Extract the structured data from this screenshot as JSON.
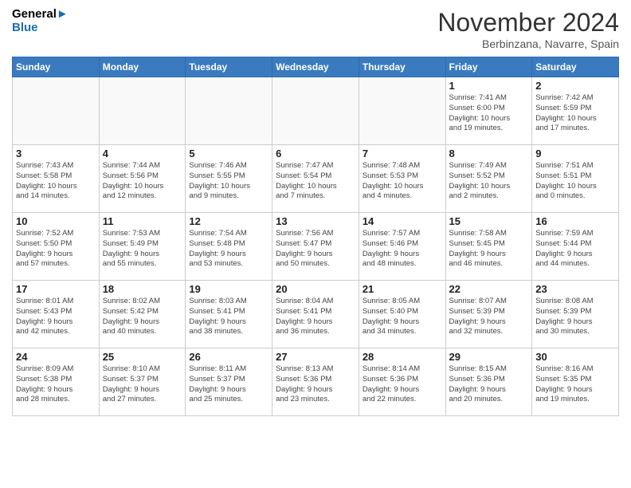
{
  "header": {
    "logo_line1": "General",
    "logo_line2": "Blue",
    "month": "November 2024",
    "location": "Berbinzana, Navarre, Spain"
  },
  "weekdays": [
    "Sunday",
    "Monday",
    "Tuesday",
    "Wednesday",
    "Thursday",
    "Friday",
    "Saturday"
  ],
  "weeks": [
    [
      {
        "day": "",
        "info": ""
      },
      {
        "day": "",
        "info": ""
      },
      {
        "day": "",
        "info": ""
      },
      {
        "day": "",
        "info": ""
      },
      {
        "day": "",
        "info": ""
      },
      {
        "day": "1",
        "info": "Sunrise: 7:41 AM\nSunset: 6:00 PM\nDaylight: 10 hours\nand 19 minutes."
      },
      {
        "day": "2",
        "info": "Sunrise: 7:42 AM\nSunset: 5:59 PM\nDaylight: 10 hours\nand 17 minutes."
      }
    ],
    [
      {
        "day": "3",
        "info": "Sunrise: 7:43 AM\nSunset: 5:58 PM\nDaylight: 10 hours\nand 14 minutes."
      },
      {
        "day": "4",
        "info": "Sunrise: 7:44 AM\nSunset: 5:56 PM\nDaylight: 10 hours\nand 12 minutes."
      },
      {
        "day": "5",
        "info": "Sunrise: 7:46 AM\nSunset: 5:55 PM\nDaylight: 10 hours\nand 9 minutes."
      },
      {
        "day": "6",
        "info": "Sunrise: 7:47 AM\nSunset: 5:54 PM\nDaylight: 10 hours\nand 7 minutes."
      },
      {
        "day": "7",
        "info": "Sunrise: 7:48 AM\nSunset: 5:53 PM\nDaylight: 10 hours\nand 4 minutes."
      },
      {
        "day": "8",
        "info": "Sunrise: 7:49 AM\nSunset: 5:52 PM\nDaylight: 10 hours\nand 2 minutes."
      },
      {
        "day": "9",
        "info": "Sunrise: 7:51 AM\nSunset: 5:51 PM\nDaylight: 10 hours\nand 0 minutes."
      }
    ],
    [
      {
        "day": "10",
        "info": "Sunrise: 7:52 AM\nSunset: 5:50 PM\nDaylight: 9 hours\nand 57 minutes."
      },
      {
        "day": "11",
        "info": "Sunrise: 7:53 AM\nSunset: 5:49 PM\nDaylight: 9 hours\nand 55 minutes."
      },
      {
        "day": "12",
        "info": "Sunrise: 7:54 AM\nSunset: 5:48 PM\nDaylight: 9 hours\nand 53 minutes."
      },
      {
        "day": "13",
        "info": "Sunrise: 7:56 AM\nSunset: 5:47 PM\nDaylight: 9 hours\nand 50 minutes."
      },
      {
        "day": "14",
        "info": "Sunrise: 7:57 AM\nSunset: 5:46 PM\nDaylight: 9 hours\nand 48 minutes."
      },
      {
        "day": "15",
        "info": "Sunrise: 7:58 AM\nSunset: 5:45 PM\nDaylight: 9 hours\nand 46 minutes."
      },
      {
        "day": "16",
        "info": "Sunrise: 7:59 AM\nSunset: 5:44 PM\nDaylight: 9 hours\nand 44 minutes."
      }
    ],
    [
      {
        "day": "17",
        "info": "Sunrise: 8:01 AM\nSunset: 5:43 PM\nDaylight: 9 hours\nand 42 minutes."
      },
      {
        "day": "18",
        "info": "Sunrise: 8:02 AM\nSunset: 5:42 PM\nDaylight: 9 hours\nand 40 minutes."
      },
      {
        "day": "19",
        "info": "Sunrise: 8:03 AM\nSunset: 5:41 PM\nDaylight: 9 hours\nand 38 minutes."
      },
      {
        "day": "20",
        "info": "Sunrise: 8:04 AM\nSunset: 5:41 PM\nDaylight: 9 hours\nand 36 minutes."
      },
      {
        "day": "21",
        "info": "Sunrise: 8:05 AM\nSunset: 5:40 PM\nDaylight: 9 hours\nand 34 minutes."
      },
      {
        "day": "22",
        "info": "Sunrise: 8:07 AM\nSunset: 5:39 PM\nDaylight: 9 hours\nand 32 minutes."
      },
      {
        "day": "23",
        "info": "Sunrise: 8:08 AM\nSunset: 5:39 PM\nDaylight: 9 hours\nand 30 minutes."
      }
    ],
    [
      {
        "day": "24",
        "info": "Sunrise: 8:09 AM\nSunset: 5:38 PM\nDaylight: 9 hours\nand 28 minutes."
      },
      {
        "day": "25",
        "info": "Sunrise: 8:10 AM\nSunset: 5:37 PM\nDaylight: 9 hours\nand 27 minutes."
      },
      {
        "day": "26",
        "info": "Sunrise: 8:11 AM\nSunset: 5:37 PM\nDaylight: 9 hours\nand 25 minutes."
      },
      {
        "day": "27",
        "info": "Sunrise: 8:13 AM\nSunset: 5:36 PM\nDaylight: 9 hours\nand 23 minutes."
      },
      {
        "day": "28",
        "info": "Sunrise: 8:14 AM\nSunset: 5:36 PM\nDaylight: 9 hours\nand 22 minutes."
      },
      {
        "day": "29",
        "info": "Sunrise: 8:15 AM\nSunset: 5:36 PM\nDaylight: 9 hours\nand 20 minutes."
      },
      {
        "day": "30",
        "info": "Sunrise: 8:16 AM\nSunset: 5:35 PM\nDaylight: 9 hours\nand 19 minutes."
      }
    ]
  ]
}
